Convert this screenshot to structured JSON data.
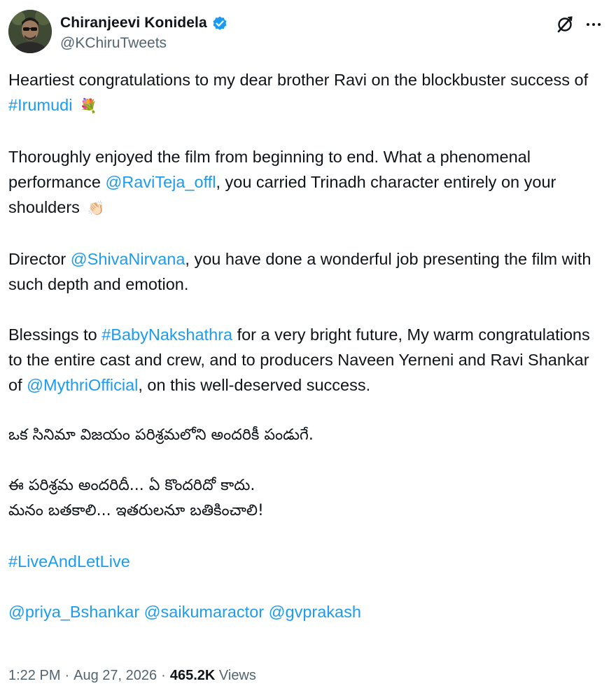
{
  "author": {
    "display_name": "Chiranjeevi Konidela",
    "handle": "@KChiruTweets",
    "verified": true,
    "avatar_icon": "avatar-photo"
  },
  "actions": {
    "grok_icon": "grok-icon",
    "more_icon": "more-icon"
  },
  "body": {
    "p1_text1": "Heartiest congratulations to my dear brother Ravi on the blockbuster success of ",
    "p1_hashtag": "#Irumudi",
    "p1_emoji": "💐",
    "p2_text1": "Thoroughly enjoyed the film from beginning to end. What a phenomenal performance ",
    "p2_mention": "@RaviTeja_offl",
    "p2_text2": ", you carried Trinadh character entirely on your shoulders",
    "p2_emoji": "👏🏻",
    "p3_text1": "Director ",
    "p3_mention": "@ShivaNirvana",
    "p3_text2": ", you have done a wonderful job presenting the film with such depth and emotion.",
    "p4_text1": "Blessings to ",
    "p4_hashtag": "#BabyNakshathra",
    "p4_text2": " for a very bright future, My warm congratulations to the entire cast and crew, and to producers Naveen Yerneni and Ravi Shankar of ",
    "p4_mention": "@MythriOfficial",
    "p4_text3": ", on this well-deserved success.",
    "telugu1": "ఒక సినిమా విజయం పరిశ్రమలోని అందరికీ పండుగే.",
    "telugu2": "ఈ పరిశ్రమ అందరిదీ... ఏ కొందరిదో కాదు.",
    "telugu3": "మనం బతకాలి... ఇతరులనూ బతికించాలి!",
    "hashtag_final": "#LiveAndLetLive",
    "mention_a": "@priya_Bshankar",
    "mention_b": "@saikumaractor",
    "mention_c": "@gvprakash"
  },
  "meta": {
    "time": "1:22 PM",
    "separator": "·",
    "date": "Aug 27, 2026",
    "views_count": "465.2K",
    "views_label": "Views"
  },
  "colors": {
    "link": "#1d9bf0",
    "text": "#0f1419",
    "secondary": "#536471",
    "verified_badge": "#1d9bf0"
  }
}
